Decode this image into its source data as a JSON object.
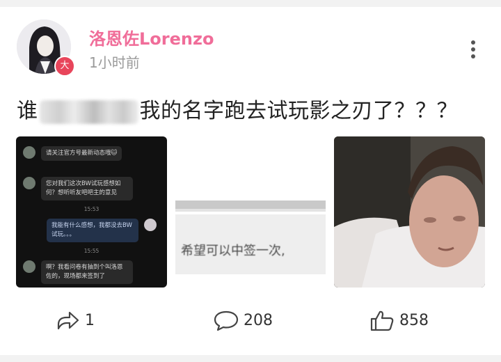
{
  "post": {
    "username": "洛恩佐Lorenzo",
    "time": "1小时前",
    "badge": "大",
    "text_before": "谁",
    "text_after": "我的名字跑去试玩影之刃了？？？"
  },
  "chat_screenshot": {
    "messages": [
      "请关注官方号最新动态哦🐱",
      "您对我们这次BW试玩感想如何？想听听友吧吧主的意见",
      "我能有什么感想，我都没去BW试玩。。。",
      "啊？我看问卷有抽到个叫洛恩佐的，现场都来签到了"
    ],
    "times": [
      "15:53",
      "15:55"
    ]
  },
  "meme_caption": "希望可以中签一次,",
  "actions": {
    "share_count": "1",
    "comment_count": "208",
    "like_count": "858"
  },
  "colors": {
    "username": "#f06d99",
    "badge": "#e8455b"
  }
}
